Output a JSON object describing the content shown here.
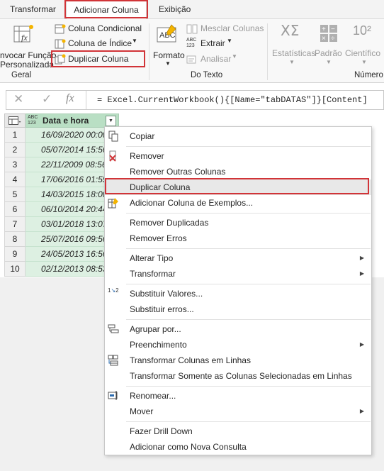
{
  "tabs": [
    {
      "label": "Transformar"
    },
    {
      "label": "Adicionar Coluna"
    },
    {
      "label": "Exibição"
    }
  ],
  "ribbon": {
    "invoke_function_line1": "nvocar Função",
    "invoke_function_line2": "Personalizada",
    "conditional_column": "Coluna Condicional",
    "index_column": "Coluna de Índice",
    "duplicate_column": "Duplicar Coluna",
    "format": "Formato",
    "merge_columns": "Mesclar Colunas",
    "extract": "Extrair",
    "parse": "Analisar",
    "statistics": "Estatísticas",
    "standard": "Padrão",
    "scientific": "Científico",
    "group_general": "Geral",
    "group_text": "Do Texto",
    "group_number": "Número",
    "abc_icon_text": "ABC",
    "abc_icon_num": "123",
    "sci_icon_text": "10²",
    "stats_icon_text": "XΣ"
  },
  "formula_bar": {
    "fx": "fx",
    "formula": "= Excel.CurrentWorkbook(){[Name=\"tabDATAS\"]}[Content]"
  },
  "grid": {
    "column_type_top": "ABC",
    "column_type_bottom": "123",
    "column_header": "Data e hora",
    "rows": [
      {
        "num": "1",
        "value": "16/09/2020 00:00"
      },
      {
        "num": "2",
        "value": "05/07/2014 15:56"
      },
      {
        "num": "3",
        "value": "22/11/2009 08:56"
      },
      {
        "num": "4",
        "value": "17/06/2016 01:55"
      },
      {
        "num": "5",
        "value": "14/03/2015 18:00"
      },
      {
        "num": "6",
        "value": "06/10/2014 20:44"
      },
      {
        "num": "7",
        "value": "03/01/2018 13:07"
      },
      {
        "num": "8",
        "value": "25/07/2016 09:56"
      },
      {
        "num": "9",
        "value": "24/05/2013 16:56"
      },
      {
        "num": "10",
        "value": "02/12/2013 08:53"
      }
    ]
  },
  "menu": {
    "copy": "Copiar",
    "remove": "Remover",
    "remove_other": "Remover Outras Colunas",
    "duplicate": "Duplicar Coluna",
    "add_from_examples": "Adicionar Coluna de Exemplos...",
    "remove_duplicates": "Remover Duplicadas",
    "remove_errors": "Remover Erros",
    "change_type": "Alterar Tipo",
    "transform": "Transformar",
    "replace_values": "Substituir Valores...",
    "replace_errors": "Substituir erros...",
    "group_by": "Agrupar por...",
    "fill": "Preenchimento",
    "unpivot": "Transformar Colunas em Linhas",
    "unpivot_selected": "Transformar Somente as Colunas Selecionadas em Linhas",
    "rename": "Renomear...",
    "move": "Mover",
    "drill_down": "Fazer Drill Down",
    "add_as_query": "Adicionar como Nova Consulta",
    "replace_icon_1": "1",
    "replace_icon_2": "2"
  },
  "colors": {
    "highlight_red": "#d13438",
    "column_header_green": "#b9dfc4",
    "cell_green": "#ddf0e2"
  }
}
